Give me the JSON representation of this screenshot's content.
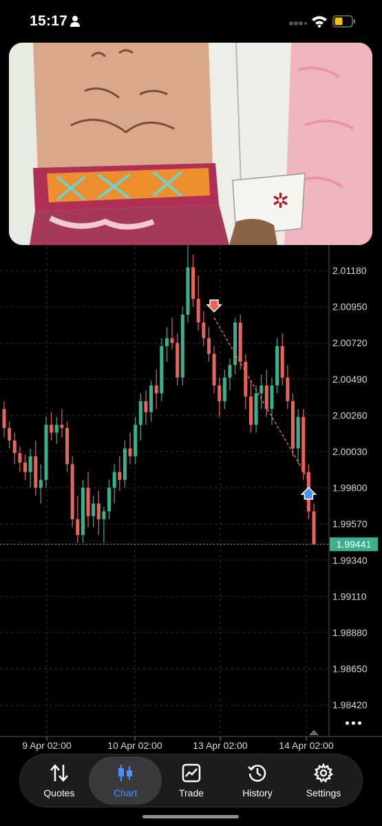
{
  "status_bar": {
    "time": "15:17",
    "battery_color": "#f5c400"
  },
  "overlay": {
    "description_icon": "video-overlay"
  },
  "chart": {
    "current_price": "1.99441",
    "current_price_color": "#3bb08f",
    "bull_color": "#3bb08f",
    "bear_color": "#e8635a"
  },
  "chart_data": {
    "type": "candlestick",
    "y_ticks": [
      "2.01180",
      "2.00950",
      "2.00720",
      "2.00490",
      "2.00260",
      "2.00030",
      "1.99800",
      "1.99570",
      "1.99340",
      "1.99110",
      "1.98880",
      "1.98650",
      "1.98420"
    ],
    "x_ticks": [
      "9 Apr 02:00",
      "10 Apr 02:00",
      "13 Apr 02:00",
      "14 Apr 02:00"
    ],
    "ylim": [
      1.9842,
      2.0141
    ],
    "current_price": 1.99441,
    "candles": [
      [
        2.003,
        2.0035,
        2.0012,
        2.0018
      ],
      [
        2.0018,
        2.0022,
        2.0005,
        2.001
      ],
      [
        2.001,
        2.0015,
        1.9995,
        2.0002
      ],
      [
        2.0002,
        2.0006,
        1.999,
        1.9996
      ],
      [
        1.9996,
        2.0001,
        1.9985,
        1.999
      ],
      [
        1.999,
        2.0005,
        1.998,
        2.0
      ],
      [
        2.0,
        2.001,
        1.9975,
        1.998
      ],
      [
        1.998,
        1.9995,
        1.997,
        1.9985
      ],
      [
        1.9985,
        2.0025,
        1.998,
        2.002
      ],
      [
        2.002,
        2.0028,
        2.001,
        2.0015
      ],
      [
        2.0015,
        2.0025,
        2.0008,
        2.002
      ],
      [
        2.002,
        2.003,
        2.0012,
        2.0018
      ],
      [
        2.0018,
        2.0022,
        1.999,
        1.9995
      ],
      [
        1.9995,
        2.0,
        1.9955,
        1.996
      ],
      [
        1.996,
        1.9975,
        1.9945,
        1.995
      ],
      [
        1.995,
        1.9985,
        1.9945,
        1.998
      ],
      [
        1.998,
        1.999,
        1.9955,
        1.9962
      ],
      [
        1.9962,
        1.9975,
        1.9955,
        1.997
      ],
      [
        1.997,
        1.9978,
        1.995,
        1.996
      ],
      [
        1.996,
        1.9968,
        1.9945,
        1.9965
      ],
      [
        1.9965,
        1.9985,
        1.996,
        1.998
      ],
      [
        1.998,
        1.9995,
        1.997,
        1.999
      ],
      [
        1.999,
        2.0,
        1.9978,
        1.9985
      ],
      [
        1.9985,
        2.001,
        1.998,
        2.0005
      ],
      [
        2.0005,
        2.0015,
        1.9995,
        2.0
      ],
      [
        2.0,
        2.0025,
        1.9995,
        2.002
      ],
      [
        2.002,
        2.004,
        2.001,
        2.0035
      ],
      [
        2.0035,
        2.0042,
        2.002,
        2.0028
      ],
      [
        2.0028,
        2.0048,
        2.0022,
        2.0045
      ],
      [
        2.0045,
        2.0055,
        2.003,
        2.004
      ],
      [
        2.004,
        2.0075,
        2.0035,
        2.007
      ],
      [
        2.007,
        2.0082,
        2.006,
        2.0075
      ],
      [
        2.0075,
        2.0088,
        2.0068,
        2.0072
      ],
      [
        2.0072,
        2.0078,
        2.0045,
        2.005
      ],
      [
        2.005,
        2.0095,
        2.0045,
        2.009
      ],
      [
        2.009,
        2.0135,
        2.0085,
        2.012
      ],
      [
        2.012,
        2.0128,
        2.0095,
        2.01
      ],
      [
        2.01,
        2.0115,
        2.008,
        2.0085
      ],
      [
        2.0085,
        2.0092,
        2.007,
        2.0075
      ],
      [
        2.0075,
        2.0082,
        2.006,
        2.0065
      ],
      [
        2.0065,
        2.007,
        2.004,
        2.0045
      ],
      [
        2.0045,
        2.005,
        2.0025,
        2.0035
      ],
      [
        2.0035,
        2.0055,
        2.003,
        2.005
      ],
      [
        2.005,
        2.0062,
        2.0042,
        2.0058
      ],
      [
        2.0058,
        2.0088,
        2.0052,
        2.0085
      ],
      [
        2.0085,
        2.009,
        2.0055,
        2.006
      ],
      [
        2.006,
        2.0065,
        2.003,
        2.0038
      ],
      [
        2.0038,
        2.0048,
        2.0015,
        2.002
      ],
      [
        2.002,
        2.0045,
        2.0015,
        2.004
      ],
      [
        2.004,
        2.0052,
        2.003,
        2.0045
      ],
      [
        2.0045,
        2.0055,
        2.0025,
        2.003
      ],
      [
        2.003,
        2.005,
        2.002,
        2.0045
      ],
      [
        2.0045,
        2.0075,
        2.004,
        2.007
      ],
      [
        2.007,
        2.0078,
        2.0045,
        2.005
      ],
      [
        2.005,
        2.0058,
        2.003,
        2.0035
      ],
      [
        2.0035,
        2.004,
        2.0,
        2.0005
      ],
      [
        2.0005,
        2.003,
        1.9995,
        2.0025
      ],
      [
        2.0025,
        2.003,
        1.9985,
        1.999
      ],
      [
        1.999,
        1.9995,
        1.996,
        1.9965
      ],
      [
        1.9965,
        1.997,
        1.9944,
        1.9944
      ]
    ],
    "trendline": {
      "from_candle": 40,
      "from_price": 2.0088,
      "to_candle": 58,
      "to_price": 1.9985
    },
    "sell_marker": {
      "candle": 40,
      "price": 2.0094
    },
    "buy_marker": {
      "candle": 58,
      "price": 1.9978
    }
  },
  "tabs": [
    {
      "label": "Quotes",
      "icon": "quotes-arrows-icon"
    },
    {
      "label": "Chart",
      "icon": "chart-candles-icon"
    },
    {
      "label": "Trade",
      "icon": "trade-chart-icon"
    },
    {
      "label": "History",
      "icon": "history-clock-icon"
    },
    {
      "label": "Settings",
      "icon": "settings-gear-icon"
    }
  ]
}
